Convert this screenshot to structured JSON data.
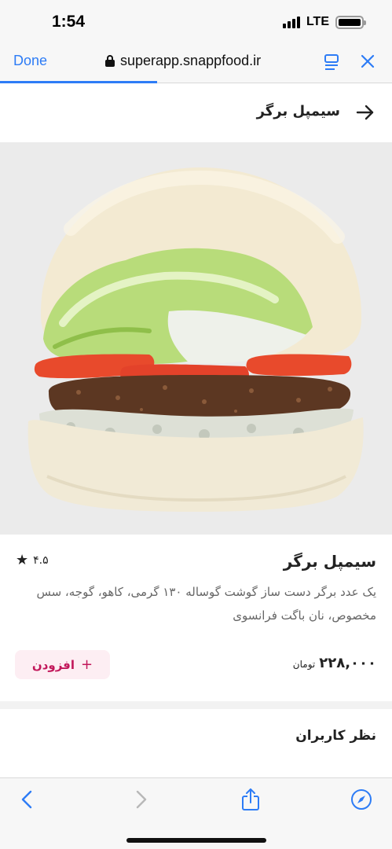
{
  "status_bar": {
    "time": "1:54",
    "network": "LTE"
  },
  "browser": {
    "done_label": "Done",
    "url": "superapp.snappfood.ir",
    "load_progress": 0.4,
    "icons": {
      "lock": "lock-icon",
      "reader": "reader-icon",
      "close": "close-icon"
    }
  },
  "header": {
    "title": "سیمپل برگر",
    "back_icon": "arrow-right-icon"
  },
  "hero": {
    "image": "burger-photo"
  },
  "product": {
    "name": "سیمپل برگر",
    "rating": "۴.۵",
    "description": "یک عدد برگر دست ساز گوشت گوساله ۱۳۰ گرمی، کاهو، گوجه، سس مخصوص، نان باگت فرانسوی",
    "price": "۲۲۸,۰۰۰",
    "currency": "تومان",
    "add_label": "افزودن",
    "accent_color": "#c2185b"
  },
  "reviews": {
    "title": "نظر کاربران"
  },
  "toolbar": {
    "icons": [
      "chevron-left-icon",
      "chevron-right-icon",
      "share-icon",
      "compass-icon"
    ]
  }
}
